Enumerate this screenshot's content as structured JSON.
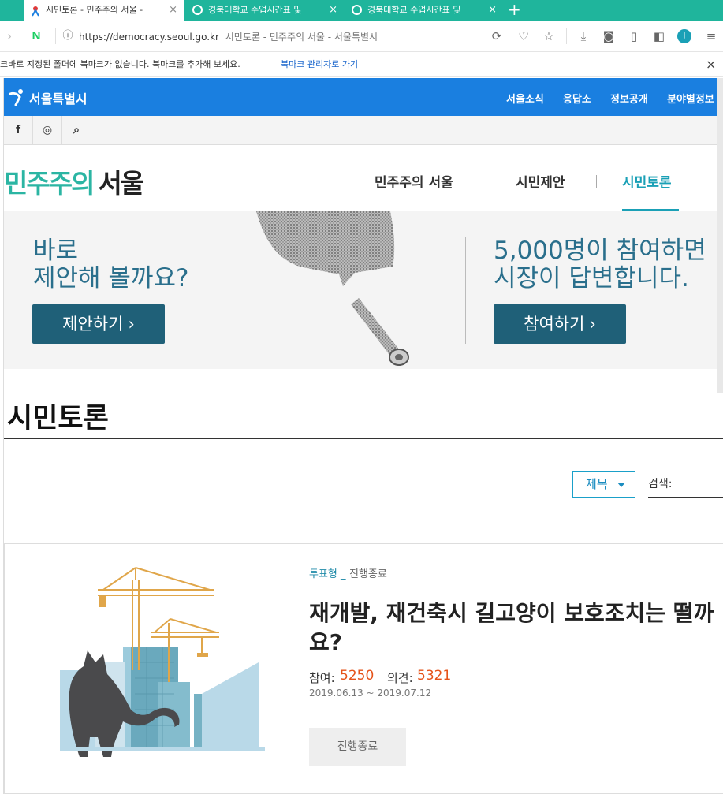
{
  "tabs": [
    {
      "title": "시민토론 - 민주주의 서울 - ",
      "close": "×",
      "active": true
    },
    {
      "title": "경북대학교 수업시간표 및",
      "close": "×",
      "active": false
    },
    {
      "title": "경북대학교 수업시간표 및",
      "close": "×",
      "active": false
    }
  ],
  "new_tab": "+",
  "address": {
    "url": "https://democracy.seoul.go.kr",
    "page_title": "시민토론 - 민주주의 서울 - 서울특별시",
    "profile_initial": "J"
  },
  "bookmark_bar": {
    "message": "크바로 지정된 폴더에 북마크가 없습니다. 북마크를 추가해 보세요.",
    "link": "북마크 관리자로 가기",
    "close": "×"
  },
  "seoul_header": {
    "logo": "서울특별시",
    "nav": [
      "서울소식",
      "응답소",
      "정보공개",
      "분야별정보"
    ]
  },
  "social": [
    "f",
    "◎",
    "⌕"
  ],
  "site": {
    "logo_part1": "민주주의",
    "logo_part2": "서울",
    "gnb": [
      "민주주의 서울",
      "시민제안",
      "시민토론"
    ],
    "active_index": 2
  },
  "banner": {
    "left_line1": "바로",
    "left_line2": "제안해 볼까요?",
    "left_button": "제안하기",
    "right_line1": "5,000명이 참여하면",
    "right_line2": "시장이 답변합니다.",
    "right_button": "참여하기"
  },
  "page_title": "시민토론",
  "search": {
    "select_value": "제목",
    "label": "검색:"
  },
  "card": {
    "type": "투표형",
    "separator": "_",
    "status": "진행종료",
    "title": "재개발, 재건축시 길고양이 보호조치는 떨까요?",
    "participants_label": "참여:",
    "participants": "5250",
    "opinions_label": "의견:",
    "opinions": "5321",
    "period": "2019.06.13 ~ 2019.07.12",
    "status_button": "진행종료"
  },
  "colors": {
    "tab_bar": "#1fb59c",
    "seoul_blue": "#1a7fe0",
    "banner_text": "#2a6f8c",
    "banner_button": "#1f6078",
    "accent_teal": "#1aa0b6",
    "stat_orange": "#e5531a"
  }
}
